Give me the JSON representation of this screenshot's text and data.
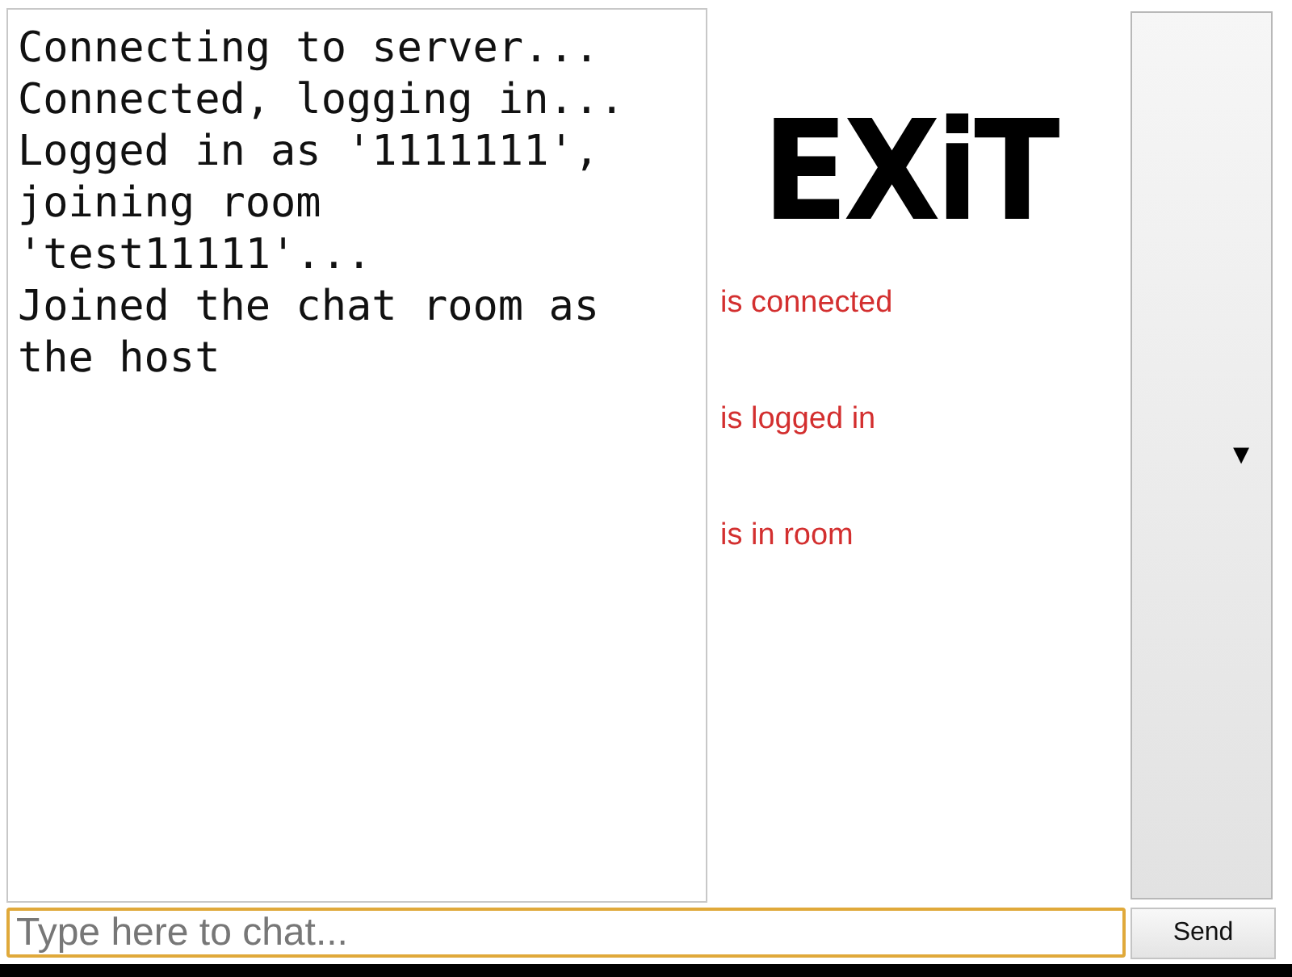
{
  "log": [
    "Connecting to server...",
    "Connected, logging in...",
    "Logged in as '1111111', joining room 'test11111'...",
    "Joined the chat room as the host"
  ],
  "logo": "EXiT",
  "statuses": [
    {
      "label": "is connected",
      "on": false
    },
    {
      "label": "is logged in",
      "on": false
    },
    {
      "label": "is in room",
      "on": false
    }
  ],
  "dropdown": {
    "arrow": "▼"
  },
  "chat": {
    "placeholder": "Type here to chat..."
  },
  "send_button": "Send"
}
